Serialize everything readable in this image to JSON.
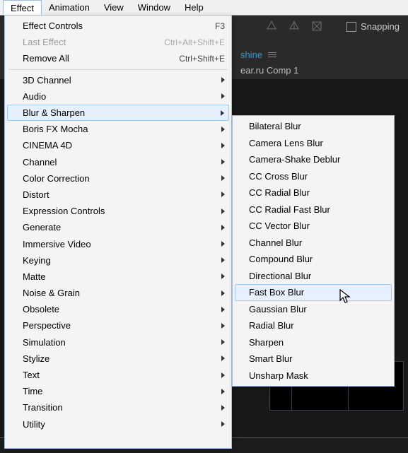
{
  "menubar": {
    "items": [
      "Effect",
      "Animation",
      "View",
      "Window",
      "Help"
    ],
    "open_index": 0
  },
  "toolbar": {
    "snapping_label": "Snapping",
    "tab_shine": "shine",
    "comp_name": "ear.ru Comp 1"
  },
  "effect_menu": {
    "top": [
      {
        "label": "Effect Controls",
        "shortcut": "F3",
        "disabled": false
      },
      {
        "label": "Last Effect",
        "shortcut": "Ctrl+Alt+Shift+E",
        "disabled": true
      },
      {
        "label": "Remove All",
        "shortcut": "Ctrl+Shift+E",
        "disabled": false
      }
    ],
    "categories": [
      {
        "label": "3D Channel"
      },
      {
        "label": "Audio"
      },
      {
        "label": "Blur & Sharpen",
        "open": true
      },
      {
        "label": "Boris FX Mocha"
      },
      {
        "label": "CINEMA 4D"
      },
      {
        "label": "Channel"
      },
      {
        "label": "Color Correction"
      },
      {
        "label": "Distort"
      },
      {
        "label": "Expression Controls"
      },
      {
        "label": "Generate"
      },
      {
        "label": "Immersive Video"
      },
      {
        "label": "Keying"
      },
      {
        "label": "Matte"
      },
      {
        "label": "Noise & Grain"
      },
      {
        "label": "Obsolete"
      },
      {
        "label": "Perspective"
      },
      {
        "label": "Simulation"
      },
      {
        "label": "Stylize"
      },
      {
        "label": "Text"
      },
      {
        "label": "Time"
      },
      {
        "label": "Transition"
      },
      {
        "label": "Utility"
      }
    ]
  },
  "blur_submenu": {
    "items": [
      "Bilateral Blur",
      "Camera Lens Blur",
      "Camera-Shake Deblur",
      "CC Cross Blur",
      "CC Radial Blur",
      "CC Radial Fast Blur",
      "CC Vector Blur",
      "Channel Blur",
      "Compound Blur",
      "Directional Blur",
      "Fast Box Blur",
      "Gaussian Blur",
      "Radial Blur",
      "Sharpen",
      "Smart Blur",
      "Unsharp Mask"
    ],
    "highlight_index": 10
  }
}
